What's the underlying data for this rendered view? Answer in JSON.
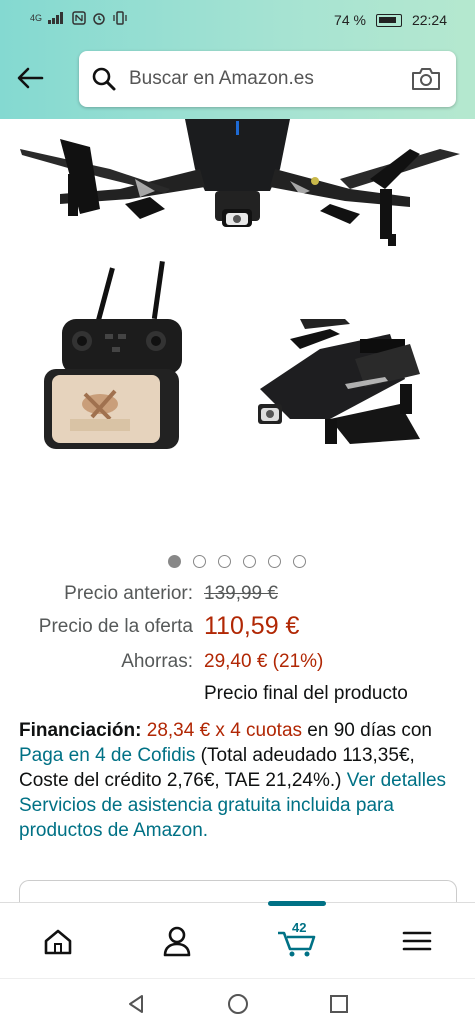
{
  "status_bar": {
    "network": "4G",
    "battery_percent": "74 %",
    "time": "22:24"
  },
  "search": {
    "placeholder": "Buscar en Amazon.es"
  },
  "carousel": {
    "total": 6,
    "active_index": 0
  },
  "pricing": {
    "previous_label": "Precio anterior:",
    "previous_value": "139,99 €",
    "offer_label": "Precio de la oferta",
    "offer_value": "110,59 €",
    "savings_label": "Ahorras:",
    "savings_value": "29,40 € (21%)",
    "final_note": "Precio final del producto"
  },
  "financing": {
    "label": "Financiación:",
    "installments": "28,34 € x 4 cuotas",
    "text1": " en 90 días con ",
    "provider_link": "Paga en 4 de Cofidis",
    "text2": " (Total adeudado 113,35€, Coste del crédito 2,76€, TAE 21,24%.) ",
    "details_link": "Ver detalles",
    "services_link": "Servicios de asistencia gratuita incluida para productos de Amazon."
  },
  "bottom_nav": {
    "cart_count": "42",
    "items": [
      "home",
      "account",
      "cart",
      "menu"
    ]
  },
  "colors": {
    "header_gradient_start": "#84d9d1",
    "header_gradient_end": "#b5e8cf",
    "price_red": "#b12704",
    "link_teal": "#007185"
  }
}
